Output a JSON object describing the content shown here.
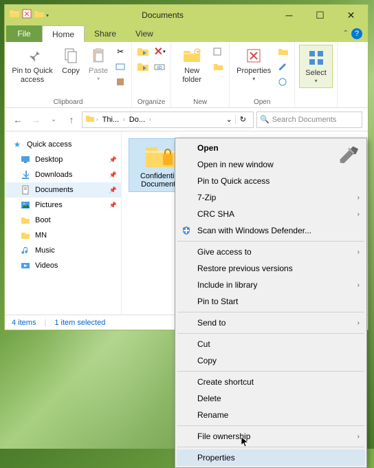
{
  "window": {
    "title": "Documents"
  },
  "tabs": {
    "file": "File",
    "home": "Home",
    "share": "Share",
    "view": "View"
  },
  "ribbon": {
    "pin": "Pin to Quick access",
    "copy": "Copy",
    "paste": "Paste",
    "clipboard": "Clipboard",
    "organize": "Organize",
    "newfolder": "New folder",
    "new": "New",
    "properties": "Properties",
    "open": "Open",
    "select": "Select"
  },
  "path": {
    "root": "Thi...",
    "current": "Do..."
  },
  "search": {
    "placeholder": "Search Documents"
  },
  "sidebar": {
    "quick": "Quick access",
    "items": [
      {
        "label": "Desktop",
        "pin": true,
        "icon": "desktop"
      },
      {
        "label": "Downloads",
        "pin": true,
        "icon": "downloads"
      },
      {
        "label": "Documents",
        "pin": true,
        "icon": "documents",
        "selected": true
      },
      {
        "label": "Pictures",
        "pin": true,
        "icon": "pictures"
      },
      {
        "label": "Boot",
        "pin": false,
        "icon": "folder"
      },
      {
        "label": "MN",
        "pin": false,
        "icon": "folder"
      },
      {
        "label": "Music",
        "pin": false,
        "icon": "music"
      },
      {
        "label": "Videos",
        "pin": false,
        "icon": "videos"
      }
    ]
  },
  "folder": {
    "name": "Confidential Documents"
  },
  "status": {
    "count": "4 items",
    "selected": "1 item selected"
  },
  "menu": {
    "open": "Open",
    "open_new": "Open in new window",
    "pin_quick": "Pin to Quick access",
    "sevenzip": "7-Zip",
    "crc": "CRC SHA",
    "defender": "Scan with Windows Defender...",
    "give_access": "Give access to",
    "restore": "Restore previous versions",
    "include": "Include in library",
    "pin_start": "Pin to Start",
    "send_to": "Send to",
    "cut": "Cut",
    "copy": "Copy",
    "create_shortcut": "Create shortcut",
    "delete": "Delete",
    "rename": "Rename",
    "file_ownership": "File ownership",
    "properties": "Properties"
  }
}
